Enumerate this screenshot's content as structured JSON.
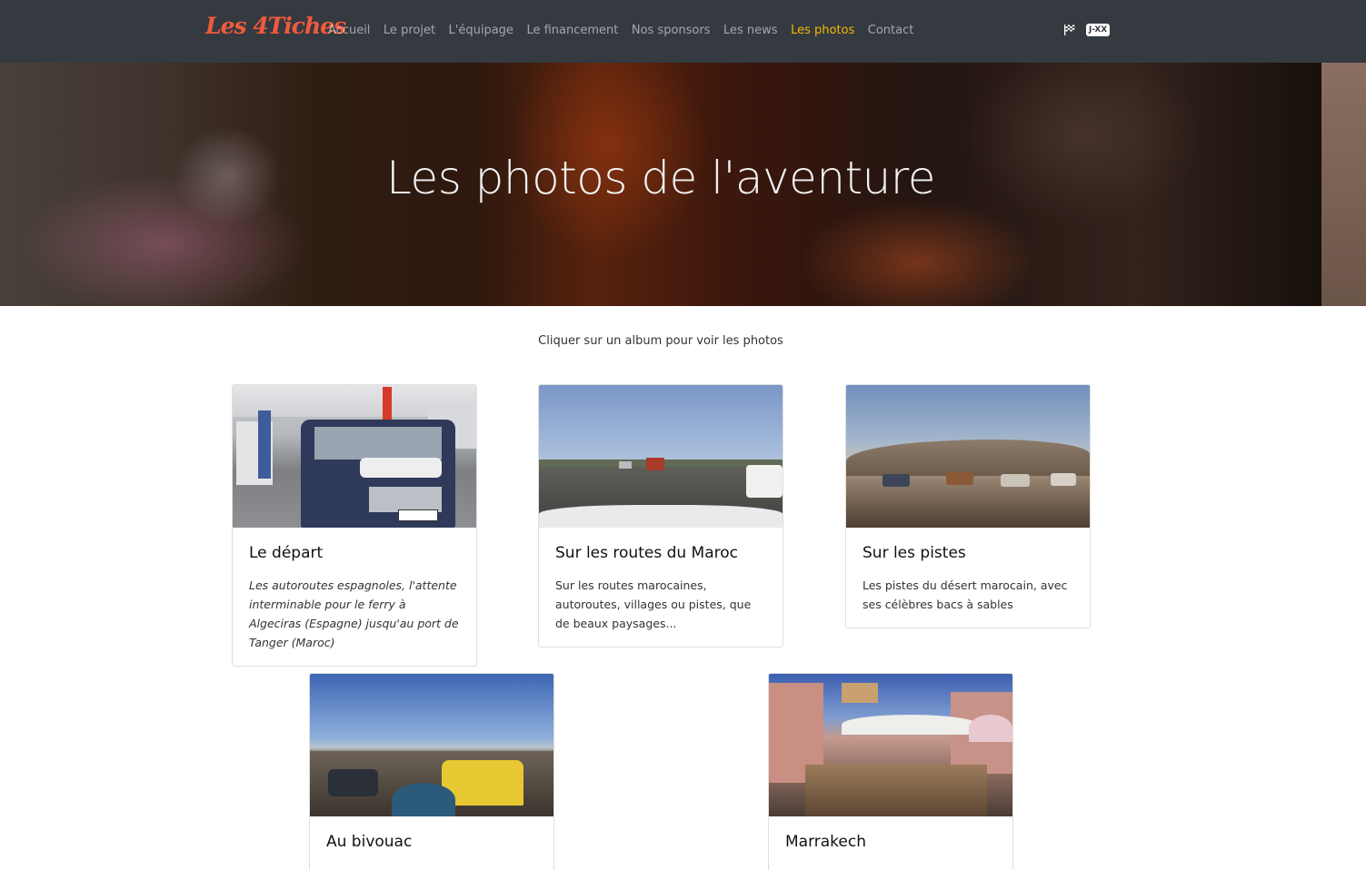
{
  "brand": "Les 4Tiches",
  "nav": {
    "items": [
      {
        "label": "Accueil"
      },
      {
        "label": "Le projet"
      },
      {
        "label": "L'équipage"
      },
      {
        "label": "Le financement"
      },
      {
        "label": "Nos sponsors"
      },
      {
        "label": "Les news"
      },
      {
        "label": "Les photos",
        "active": true
      },
      {
        "label": "Contact"
      }
    ],
    "flag_icon": "checkered-flag-icon",
    "countdown": "J-XX"
  },
  "hero": {
    "title": "Les photos de l'aventure"
  },
  "intro": "Cliquer sur un album pour voir les photos",
  "albums": [
    {
      "title": "Le départ",
      "text": "Les autoroutes espagnoles, l'attente interminable pour le ferry à Algeciras (Espagne) jusqu'au port de Tanger (Maroc)"
    },
    {
      "title": "Sur les routes du Maroc",
      "text": "Sur les routes marocaines, autoroutes, villages ou pistes, que de beaux paysages..."
    },
    {
      "title": "Sur les pistes",
      "text": "Les pistes du désert marocain, avec ses célèbres bacs à sables"
    },
    {
      "title": "Au bivouac",
      "text": ""
    },
    {
      "title": "Marrakech",
      "text": ""
    }
  ],
  "colors": {
    "navbar": "#343a40",
    "active": "#f5b800",
    "brand": "#f05a3c"
  }
}
